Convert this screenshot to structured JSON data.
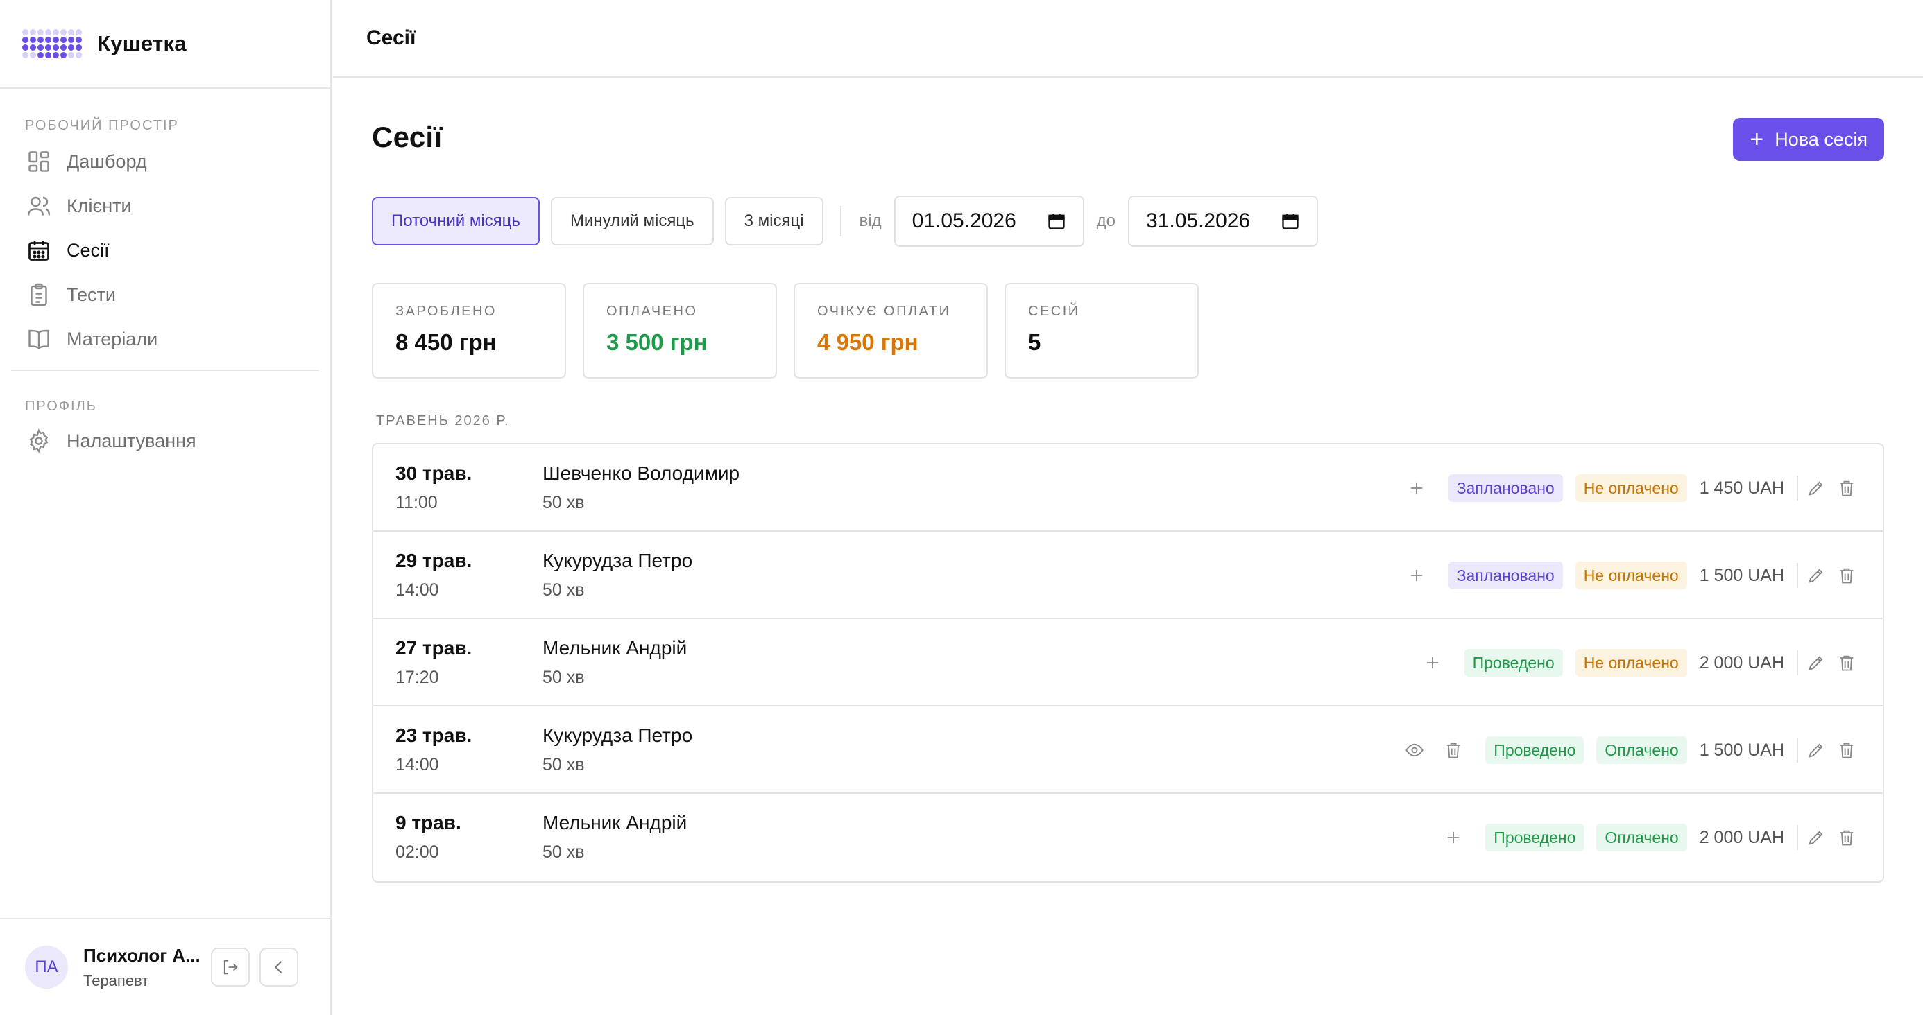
{
  "brand": {
    "name": "Кушетка"
  },
  "sidebar": {
    "workspace_label": "РОБОЧИЙ ПРОСТІР",
    "items": [
      {
        "label": "Дашборд",
        "icon": "dashboard-icon"
      },
      {
        "label": "Клієнти",
        "icon": "users-icon"
      },
      {
        "label": "Сесії",
        "icon": "calendar-icon",
        "active": true
      },
      {
        "label": "Тести",
        "icon": "clipboard-icon"
      },
      {
        "label": "Матеріали",
        "icon": "book-icon"
      }
    ],
    "profile_label": "ПРОФІЛЬ",
    "settings_label": "Налаштування"
  },
  "user": {
    "initials": "ПА",
    "name": "Психолог А...",
    "role": "Терапевт"
  },
  "topbar": {
    "title": "Сесії"
  },
  "page": {
    "title": "Сесії",
    "new_button": "Нова сесія"
  },
  "filters": {
    "presets": [
      "Поточний місяць",
      "Минулий місяць",
      "3 місяці"
    ],
    "from_label": "від",
    "from_value": "01.05.2026",
    "to_label": "до",
    "to_value": "31.05.2026"
  },
  "stats": [
    {
      "label": "ЗАРОБЛЕНО",
      "value": "8 450 грн",
      "color": "#111111"
    },
    {
      "label": "ОПЛАЧЕНО",
      "value": "3 500 грн",
      "color": "#1f9a4a"
    },
    {
      "label": "ОЧІКУЄ ОПЛАТИ",
      "value": "4 950 грн",
      "color": "#d97706"
    },
    {
      "label": "СЕСІЙ",
      "value": "5",
      "color": "#111111"
    }
  ],
  "month_label": "ТРАВЕНЬ 2026 Р.",
  "sessions": [
    {
      "date": "30 трав.",
      "time": "11:00",
      "client": "Шевченко Володимир",
      "duration": "50 хв",
      "status": "Заплановано",
      "payment": "Не оплачено",
      "amount": "1 450 UAH",
      "has_note": false
    },
    {
      "date": "29 трав.",
      "time": "14:00",
      "client": "Кукурудза Петро",
      "duration": "50 хв",
      "status": "Заплановано",
      "payment": "Не оплачено",
      "amount": "1 500 UAH",
      "has_note": false
    },
    {
      "date": "27 трав.",
      "time": "17:20",
      "client": "Мельник Андрій",
      "duration": "50 хв",
      "status": "Проведено",
      "payment": "Не оплачено",
      "amount": "2 000 UAH",
      "has_note": false
    },
    {
      "date": "23 трав.",
      "time": "14:00",
      "client": "Кукурудза Петро",
      "duration": "50 хв",
      "status": "Проведено",
      "payment": "Оплачено",
      "amount": "1 500 UAH",
      "has_note": true
    },
    {
      "date": "9 трав.",
      "time": "02:00",
      "client": "Мельник Андрій",
      "duration": "50 хв",
      "status": "Проведено",
      "payment": "Оплачено",
      "amount": "2 000 UAH",
      "has_note": false
    }
  ]
}
